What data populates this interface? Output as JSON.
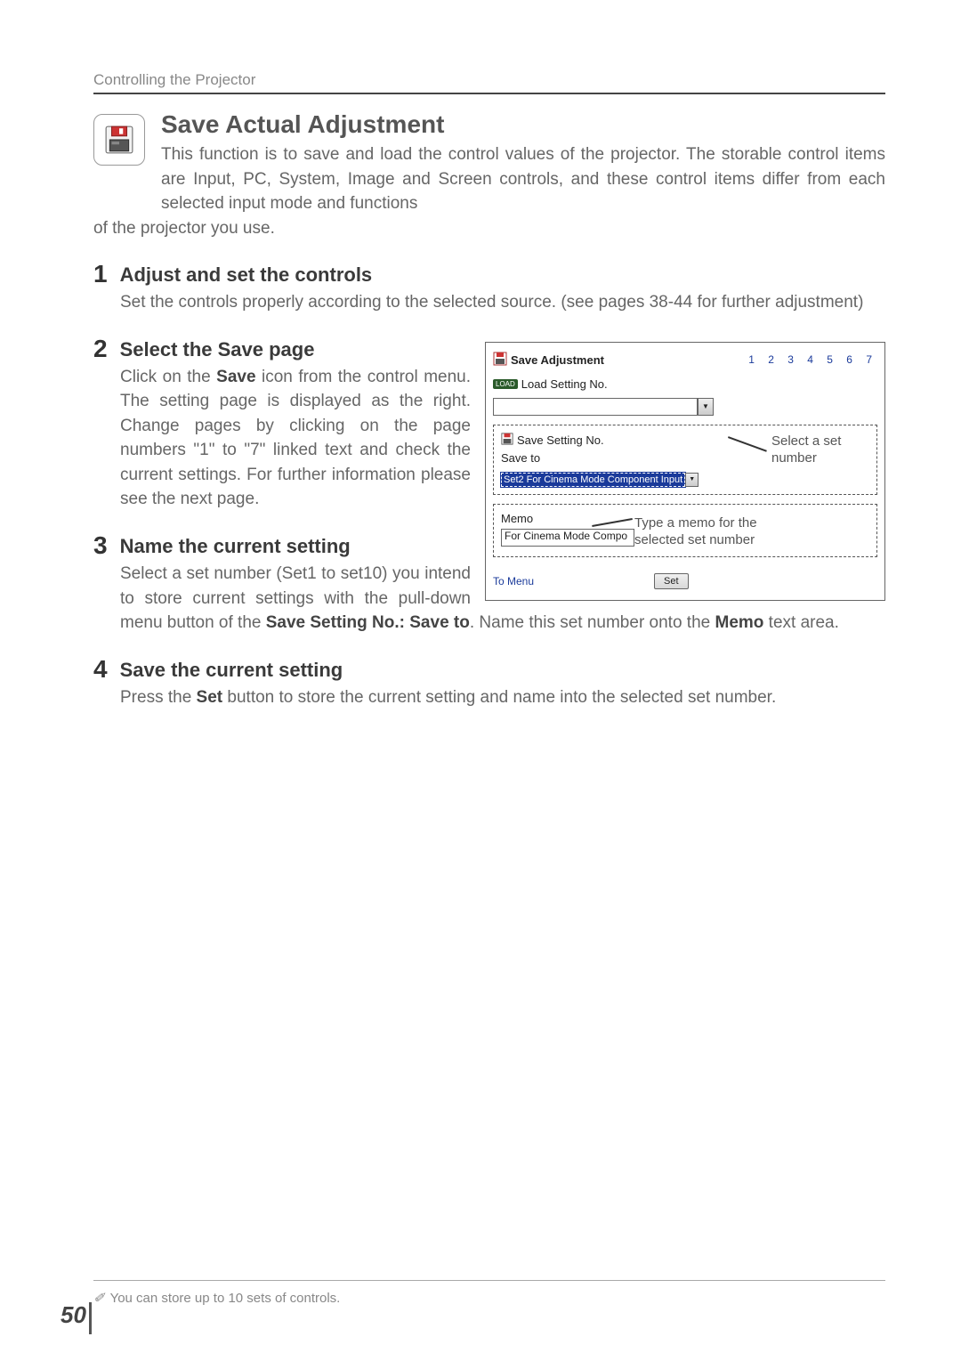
{
  "header": "Controlling the Projector",
  "title": "Save Actual Adjustment",
  "intro1": "This function is to save and load the control values of the projector. The storable control items are Input, PC, System, Image and Screen controls, and these control items differ from each selected input mode and functions",
  "intro2": "of the projector you use.",
  "step1": {
    "num": "1",
    "title": "Adjust and set the controls",
    "body_a": "Set the controls properly according to the selected source. (see pages 38-44 for further adjustment)"
  },
  "step2": {
    "num": "2",
    "title": "Select the Save page",
    "body_a": "Click on the ",
    "body_b": "Save",
    "body_c": " icon from the control menu. The setting page is displayed as the right. Change pages by clicking on the page numbers \"1\" to \"7\" linked text and check the current settings. For further information please see the next page."
  },
  "step3": {
    "num": "3",
    "title": "Name the current setting",
    "body_a": "Select a set number (Set1 to set10) you intend to store current settings with the pull-down menu button of the ",
    "body_b": "Save Setting No.: Save to",
    "body_c": ". Name this set number onto the ",
    "body_d": "Memo",
    "body_e": " text area."
  },
  "step4": {
    "num": "4",
    "title": "Save the current setting",
    "body_a": "Press the ",
    "body_b": "Set",
    "body_c": " button to store the current setting and name into the selected set number."
  },
  "screenshot": {
    "title": "Save Adjustment",
    "pages": "1 2 3 4 5 6 7",
    "load_label": "Load Setting No.",
    "save_label": "Save Setting No.",
    "save_to": "Save to",
    "selected": "Set2 For Cinema Mode Component Input",
    "memo_label": "Memo",
    "memo_value": "For Cinema Mode Compo",
    "to_menu": "To Menu",
    "set_btn": "Set",
    "callout1": "Select a set number",
    "callout2": "Type a memo for the selected set number"
  },
  "footnote": "You can store up to 10 sets of controls.",
  "page_number": "50"
}
